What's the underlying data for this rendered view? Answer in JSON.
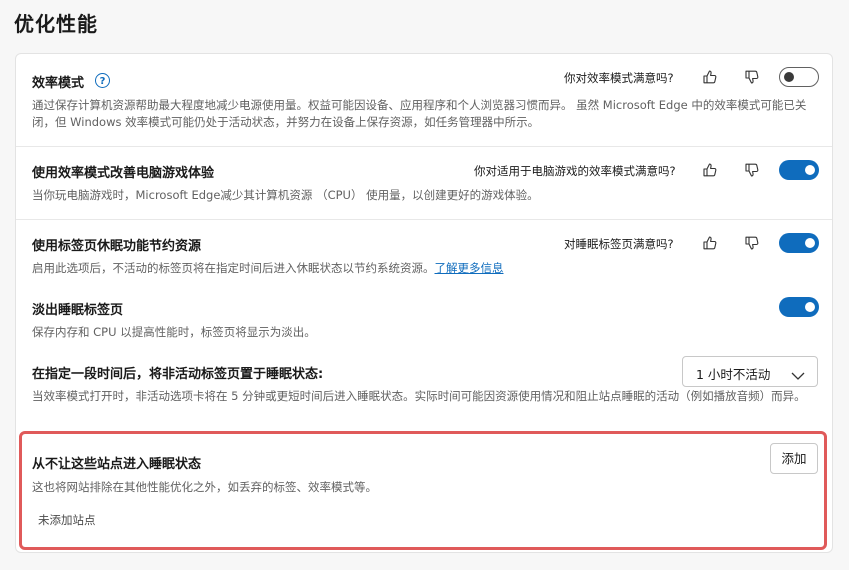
{
  "page": {
    "title": "优化性能"
  },
  "efficiency": {
    "title": "效率模式",
    "help_icon": "question-circle-icon",
    "question": "你对效率模式满意吗?",
    "description": "通过保存计算机资源帮助最大程度地减少电源使用量。权益可能因设备、应用程序和个人浏览器习惯而异。 虽然 Microsoft Edge 中的效率模式可能已关闭，但 Windows 效率模式可能仍处于活动状态，并努力在设备上保存资源，如任务管理器中所示。",
    "toggle_on": false
  },
  "gaming": {
    "title": "使用效率模式改善电脑游戏体验",
    "question": "你对适用于电脑游戏的效率模式满意吗?",
    "description": "当你玩电脑游戏时，Microsoft Edge减少其计算机资源 （CPU） 使用量，以创建更好的游戏体验。",
    "toggle_on": true
  },
  "sleeping": {
    "title": "使用标签页休眠功能节约资源",
    "question": "对睡眠标签页满意吗?",
    "description": "启用此选项后，不活动的标签页将在指定时间后进入休眠状态以节约系统资源。",
    "link": "了解更多信息",
    "toggle_on": true
  },
  "fade": {
    "title": "淡出睡眠标签页",
    "description": "保存内存和 CPU 以提高性能时，标签页将显示为淡出。",
    "toggle_on": true
  },
  "timeout": {
    "title": "在指定一段时间后，将非活动标签页置于睡眠状态:",
    "selected": "1 小时不活动",
    "description": "当效率模式打开时，非活动选项卡将在 5 分钟或更短时间后进入睡眠状态。实际时间可能因资源使用情况和阻止站点睡眠的活动（例如播放音频）而异。"
  },
  "never_sleep": {
    "title": "从不让这些站点进入睡眠状态",
    "add_label": "添加",
    "description": "这也将网站排除在其他性能优化之外，如丢弃的标签、效率模式等。",
    "empty_text": "未添加站点"
  },
  "colors": {
    "accent": "#0f6cbd",
    "highlight": "#e05a5a"
  }
}
